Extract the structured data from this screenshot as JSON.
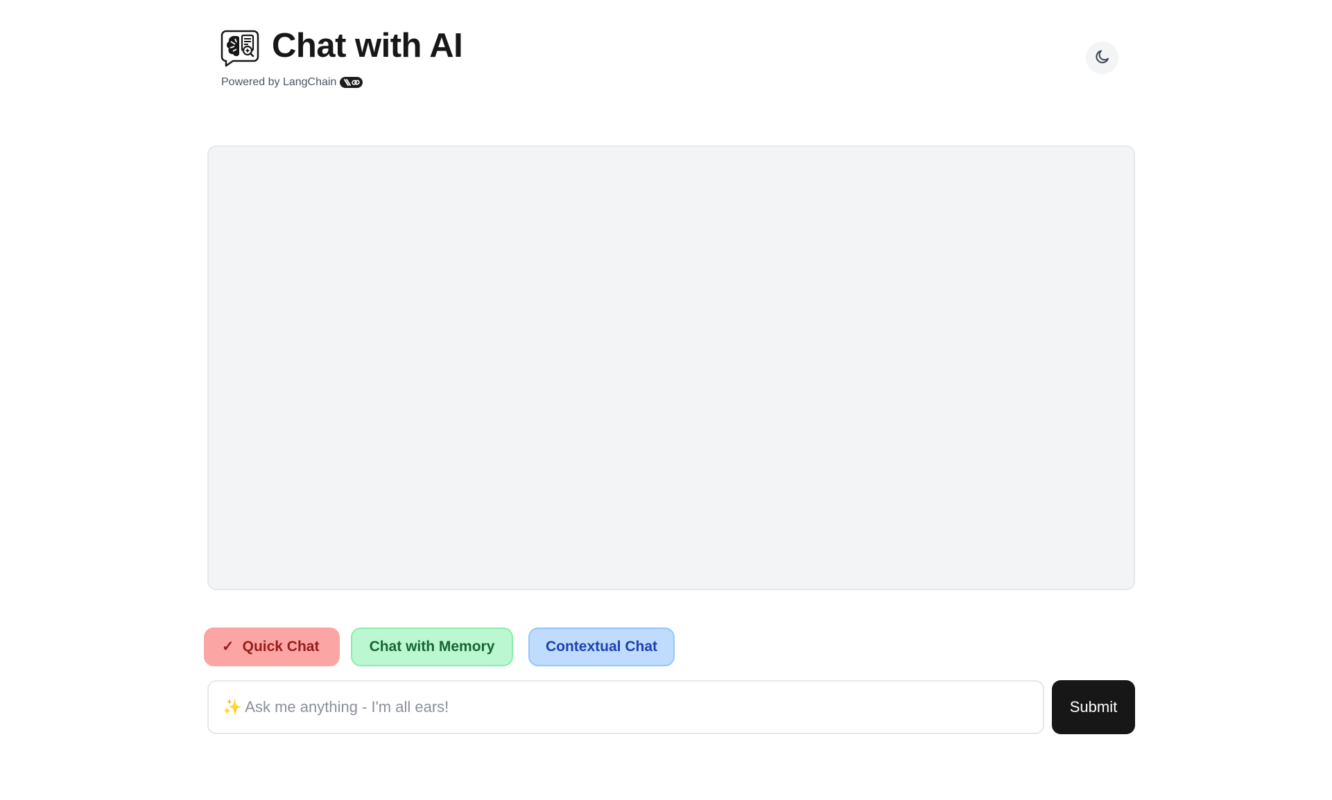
{
  "header": {
    "logo_icon": "brain-chat-icon",
    "title": "Chat with AI",
    "subtitle": "Powered by LangChain",
    "badge_icon": "langchain-parrot-link-icon",
    "theme_toggle_icon": "moon-icon"
  },
  "chat": {
    "messages": []
  },
  "modes": {
    "quick": {
      "check": "✓",
      "label": "Quick Chat",
      "selected": true
    },
    "memory": {
      "label": "Chat with Memory",
      "selected": false
    },
    "contextual": {
      "label": "Contextual Chat",
      "selected": false
    }
  },
  "input": {
    "placeholder": "✨ Ask me anything - I'm all ears!",
    "value": ""
  },
  "submit": {
    "label": "Submit"
  },
  "colors": {
    "quick_bg": "#fca5a5",
    "quick_text": "#991b1b",
    "memory_bg": "#bbf7d0",
    "memory_text": "#166534",
    "contextual_bg": "#bfdbfe",
    "contextual_text": "#1e40af",
    "submit_bg": "#171717",
    "chat_area_bg": "#f3f4f6"
  }
}
